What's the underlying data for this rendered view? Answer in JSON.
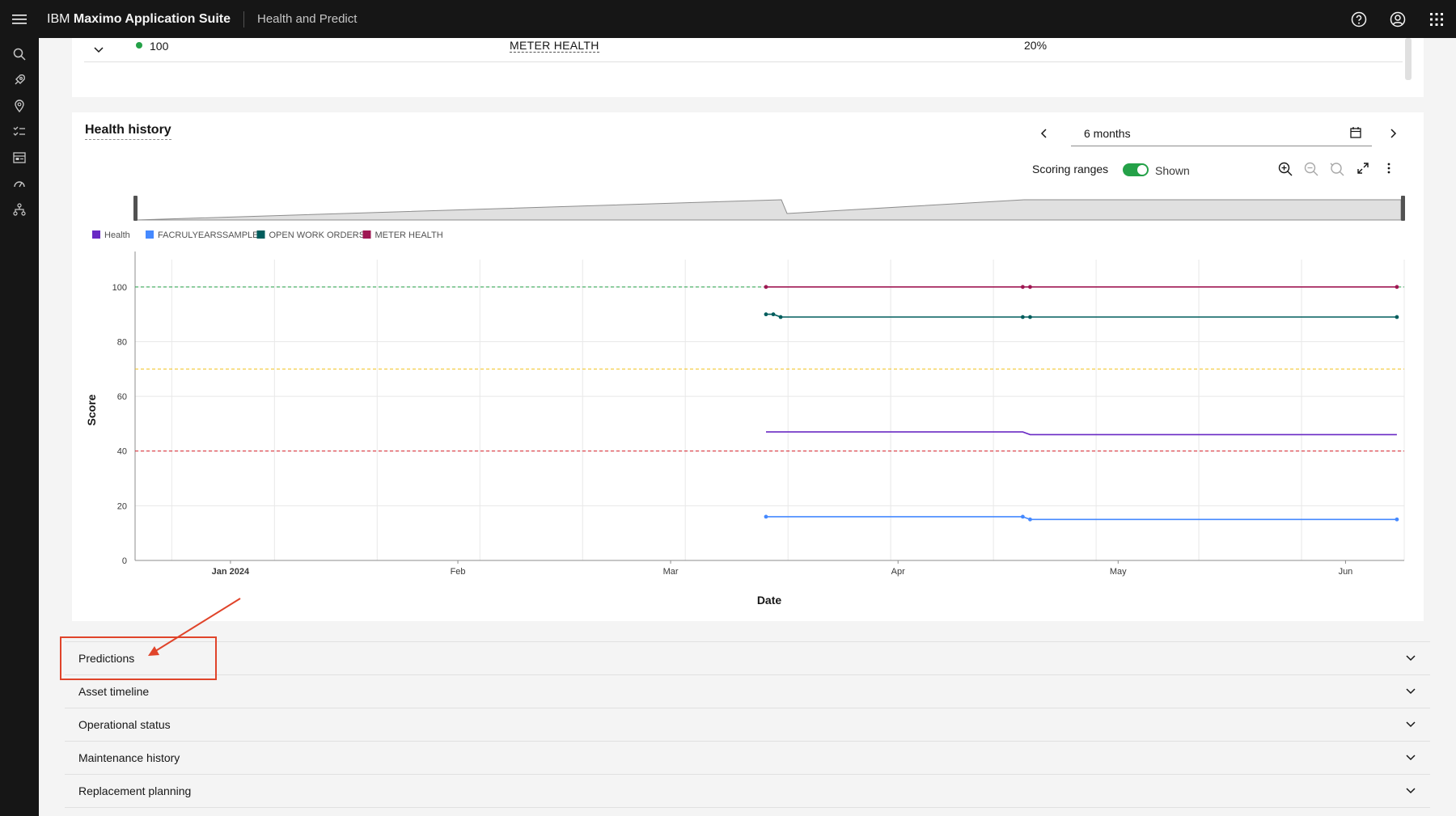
{
  "header": {
    "brand_prefix": "IBM",
    "brand_name": "Maximo Application Suite",
    "app_name": "Health and Predict"
  },
  "top_row": {
    "value": "100",
    "meter_name": "METER HEALTH",
    "percent": "20%",
    "status_color": "#24a148"
  },
  "health_history": {
    "title": "Health history",
    "range_label": "6 months",
    "scoring_ranges_label": "Scoring ranges",
    "toggle_state": "Shown"
  },
  "chart_data": {
    "type": "line",
    "xlabel": "Date",
    "ylabel": "Score",
    "ylim": [
      0,
      110
    ],
    "yticks": [
      0,
      20,
      40,
      60,
      80,
      100
    ],
    "x_ticks": [
      "Jan 2024",
      "Feb",
      "Mar",
      "Apr",
      "May",
      "Jun"
    ],
    "x_tick_dates": [
      "2024-01-01",
      "2024-02-01",
      "2024-03-01",
      "2024-04-01",
      "2024-05-01",
      "2024-06-01"
    ],
    "xlim": [
      "2023-12-19",
      "2024-06-09"
    ],
    "thresholds": [
      {
        "value": 100,
        "color": "#24a148"
      },
      {
        "value": 70,
        "color": "#f1c21b"
      },
      {
        "value": 40,
        "color": "#da1e28"
      }
    ],
    "series": [
      {
        "name": "Health",
        "color": "#6929c4",
        "markers": false,
        "points": [
          [
            "2024-03-14",
            47
          ],
          [
            "2024-04-18",
            47
          ],
          [
            "2024-04-19",
            46
          ],
          [
            "2024-06-08",
            46
          ]
        ]
      },
      {
        "name": "FACRULYEARSSAMPLE",
        "color": "#4589ff",
        "markers": true,
        "points": [
          [
            "2024-03-14",
            16
          ],
          [
            "2024-04-18",
            16
          ],
          [
            "2024-04-19",
            15
          ],
          [
            "2024-06-08",
            15
          ]
        ]
      },
      {
        "name": "OPEN WORK ORDERS",
        "color": "#005d5d",
        "markers": true,
        "points": [
          [
            "2024-03-14",
            90
          ],
          [
            "2024-03-15",
            90
          ],
          [
            "2024-03-16",
            89
          ],
          [
            "2024-04-18",
            89
          ],
          [
            "2024-04-19",
            89
          ],
          [
            "2024-06-08",
            89
          ]
        ]
      },
      {
        "name": "METER HEALTH",
        "color": "#9f1853",
        "markers": true,
        "points": [
          [
            "2024-03-14",
            100
          ],
          [
            "2024-04-18",
            100
          ],
          [
            "2024-04-19",
            100
          ],
          [
            "2024-06-08",
            100
          ]
        ]
      }
    ]
  },
  "accordions": [
    {
      "label": "Predictions"
    },
    {
      "label": "Asset timeline"
    },
    {
      "label": "Operational status"
    },
    {
      "label": "Maintenance history"
    },
    {
      "label": "Replacement planning"
    }
  ],
  "annotation_color": "#e0442a"
}
